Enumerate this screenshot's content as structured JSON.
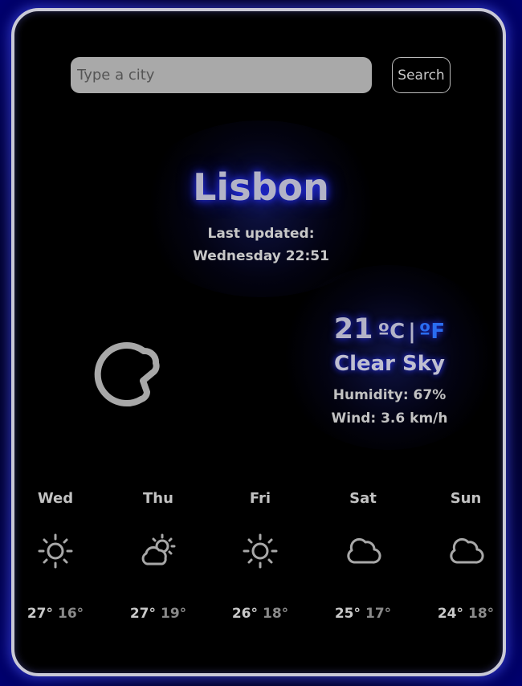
{
  "search": {
    "placeholder": "Type a city",
    "button_label": "Search"
  },
  "current": {
    "city": "Lisbon",
    "updated_label": "Last updated:",
    "updated_time": "Wednesday 22:51",
    "temperature": "21",
    "unit_celsius": "ºC",
    "unit_separator": "|",
    "unit_fahrenheit": "ºF",
    "condition": "Clear Sky",
    "condition_icon": "moon-icon",
    "humidity": "Humidity: 67%",
    "wind": "Wind: 3.6 km/h"
  },
  "forecast": [
    {
      "day": "Wed",
      "icon": "sun-icon",
      "max": "27°",
      "min": "16°"
    },
    {
      "day": "Thu",
      "icon": "sun-cloud-icon",
      "max": "27°",
      "min": "19°"
    },
    {
      "day": "Fri",
      "icon": "sun-icon",
      "max": "26°",
      "min": "18°"
    },
    {
      "day": "Sat",
      "icon": "cloud-icon",
      "max": "25°",
      "min": "17°"
    },
    {
      "day": "Sun",
      "icon": "cloud-icon",
      "max": "24°",
      "min": "18°"
    }
  ],
  "colors": {
    "background": "#000000",
    "accent_glow": "#2a34ff",
    "fahrenheit_link": "#2a6df0",
    "icon_stroke": "#a8a8a8"
  }
}
